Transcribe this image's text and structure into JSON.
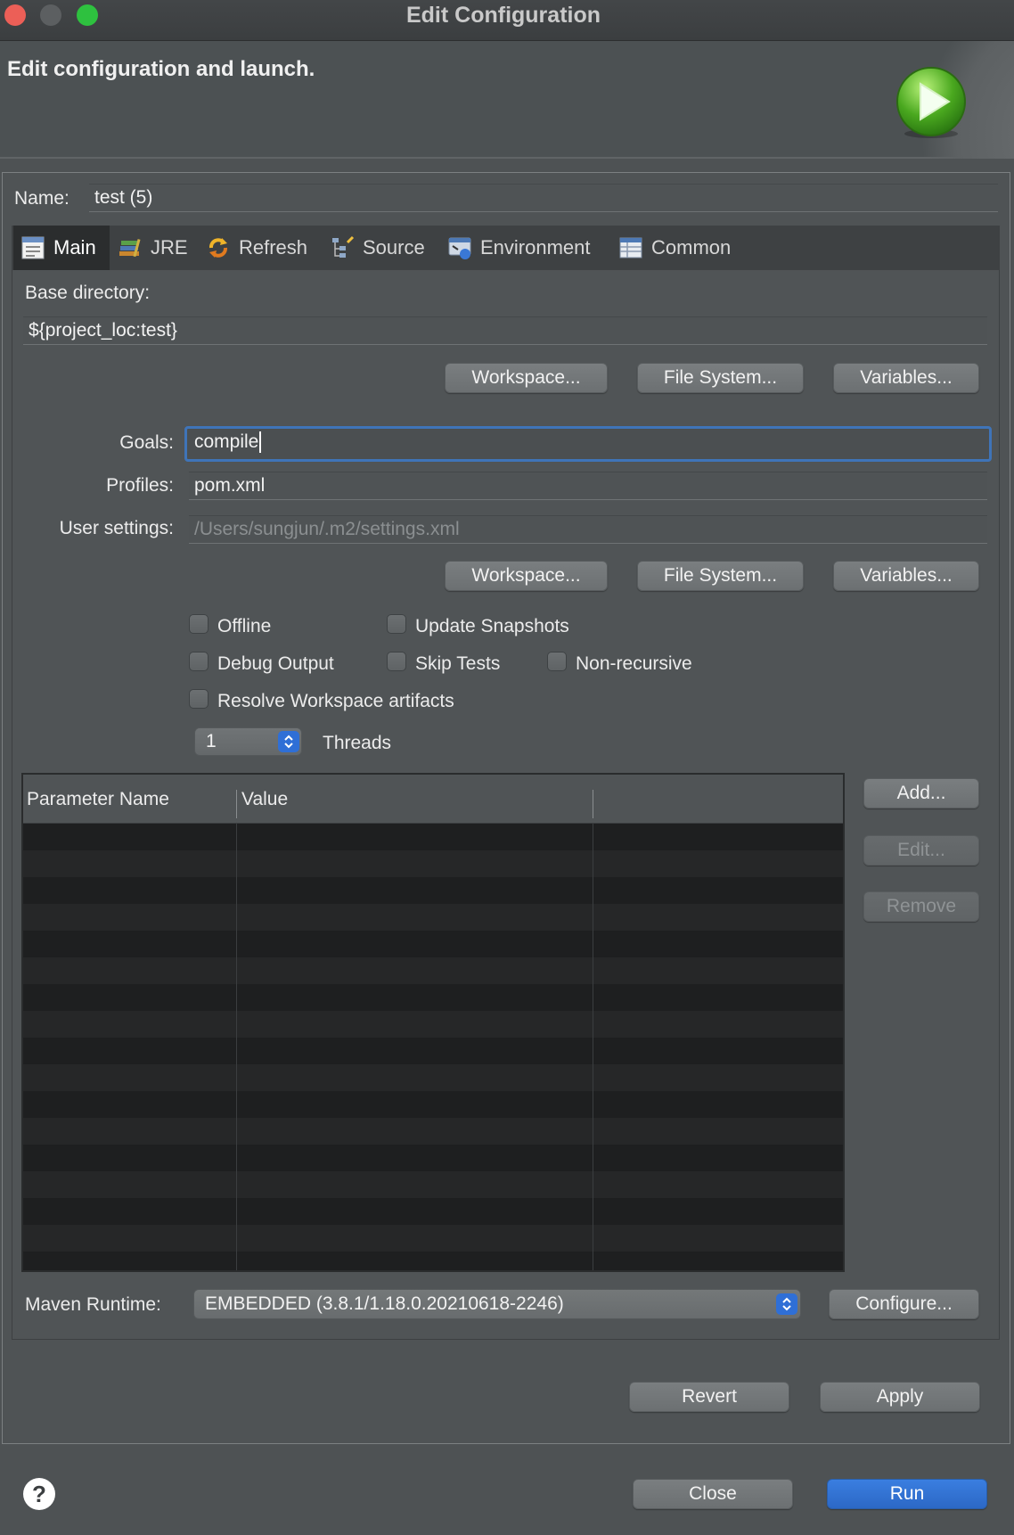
{
  "window": {
    "title": "Edit Configuration",
    "buttons": {
      "close_color": "#ec5f57",
      "minimize_color": "#5c5f61",
      "zoom_color": "#2ec13f"
    }
  },
  "banner": {
    "title": "Edit configuration and launch.",
    "icon": "run-launch-icon"
  },
  "name": {
    "label": "Name:",
    "value": "test (5)"
  },
  "tabs": [
    {
      "label": "Main",
      "icon": "main-tab-icon",
      "active": true
    },
    {
      "label": "JRE",
      "icon": "jre-library-icon"
    },
    {
      "label": "Refresh",
      "icon": "refresh-icon"
    },
    {
      "label": "Source",
      "icon": "source-tree-icon"
    },
    {
      "label": "Environment",
      "icon": "environment-icon"
    },
    {
      "label": "Common",
      "icon": "common-table-icon"
    }
  ],
  "main": {
    "base_directory_label": "Base directory:",
    "base_directory_value": "${project_loc:test}",
    "buttons1": {
      "workspace": "Workspace...",
      "file_system": "File System...",
      "variables": "Variables..."
    },
    "goals_label": "Goals:",
    "goals_value": "compile",
    "profiles_label": "Profiles:",
    "profiles_value": "pom.xml",
    "user_settings_label": "User settings:",
    "user_settings_value": "/Users/sungjun/.m2/settings.xml",
    "buttons2": {
      "workspace": "Workspace...",
      "file_system": "File System...",
      "variables": "Variables..."
    },
    "checkboxes": {
      "offline": "Offline",
      "update_snapshots": "Update Snapshots",
      "debug_output": "Debug Output",
      "skip_tests": "Skip Tests",
      "non_recursive": "Non-recursive",
      "resolve_workspace": "Resolve Workspace artifacts"
    },
    "threads_value": "1",
    "threads_label": "Threads",
    "table": {
      "columns": [
        "Parameter Name",
        "Value",
        ""
      ],
      "rows": []
    },
    "table_buttons": {
      "add": "Add...",
      "edit": "Edit...",
      "remove": "Remove"
    },
    "maven_runtime_label": "Maven Runtime:",
    "maven_runtime_value": "EMBEDDED (3.8.1/1.18.0.20210618-2246)",
    "configure": "Configure..."
  },
  "actions": {
    "revert": "Revert",
    "apply": "Apply"
  },
  "footer": {
    "help": "?",
    "close": "Close",
    "run": "Run"
  }
}
